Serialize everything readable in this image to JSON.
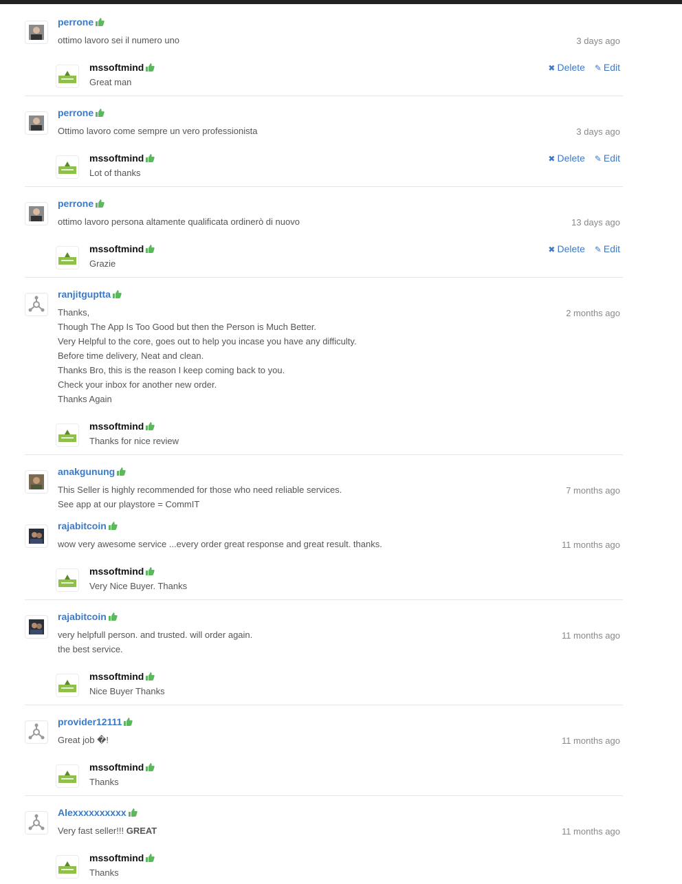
{
  "colors": {
    "link": "#3a7ac8",
    "thumb": "#5cb85c",
    "topbar": "#222222"
  },
  "labels": {
    "delete": "Delete",
    "edit": "Edit"
  },
  "reviews": [
    {
      "user": "perrone",
      "avatar": "photo-gray",
      "lines": [
        "ottimo lavoro sei il numero uno"
      ],
      "time": "3 days ago",
      "reply": {
        "user": "mssoftmind",
        "text": "Great man",
        "actions": true
      }
    },
    {
      "user": "perrone",
      "avatar": "photo-gray",
      "lines": [
        "Ottimo lavoro come sempre un vero professionista"
      ],
      "time": "3 days ago",
      "reply": {
        "user": "mssoftmind",
        "text": "Lot of thanks",
        "actions": true
      }
    },
    {
      "user": "perrone",
      "avatar": "photo-gray",
      "lines": [
        "ottimo lavoro persona altamente qualificata ordinerò di nuovo"
      ],
      "time": "13 days ago",
      "reply": {
        "user": "mssoftmind",
        "text": "Grazie",
        "actions": true
      }
    },
    {
      "user": "ranjitguptta",
      "avatar": "default-user-icon",
      "lines": [
        "Thanks,",
        "Though The App Is Too Good but then the Person is Much Better.",
        "Very Helpful to the core, goes out to help you incase you have any difficulty.",
        "Before time delivery, Neat and clean.",
        "Thanks Bro, this is the reason I keep coming back to you.",
        "Check your inbox for another new order.",
        "Thanks Again"
      ],
      "time": "2 months ago",
      "reply": {
        "user": "mssoftmind",
        "text": "Thanks for nice review",
        "actions": false
      }
    },
    {
      "user": "anakgunung",
      "avatar": "photo-color",
      "lines": [
        "This Seller is highly recommended for those who need reliable services.",
        "See app at our playstore = CommIT"
      ],
      "time": "7 months ago"
    },
    {
      "user": "rajabitcoin",
      "avatar": "photo-dark",
      "lines": [
        "wow very awesome service ...every order great response and great result. thanks."
      ],
      "time": "11 months ago",
      "reply": {
        "user": "mssoftmind",
        "text": "Very Nice Buyer. Thanks",
        "actions": false
      }
    },
    {
      "user": "rajabitcoin",
      "avatar": "photo-dark",
      "lines": [
        "very helpfull person. and trusted. will order again.",
        "the best service."
      ],
      "time": "11 months ago",
      "reply": {
        "user": "mssoftmind",
        "text": "Nice Buyer Thanks",
        "actions": false
      }
    },
    {
      "user": "provider12111",
      "avatar": "default-user-icon",
      "lines": [
        "Great job �!"
      ],
      "time": "11 months ago",
      "reply": {
        "user": "mssoftmind",
        "text": "Thanks",
        "actions": false
      }
    },
    {
      "user": "Alexxxxxxxxxx",
      "avatar": "default-user-icon",
      "lines": [
        "Very fast seller!!! "
      ],
      "bold_suffix": "GREAT",
      "time": "11 months ago",
      "reply": {
        "user": "mssoftmind",
        "text": "Thanks",
        "actions": false
      }
    }
  ]
}
